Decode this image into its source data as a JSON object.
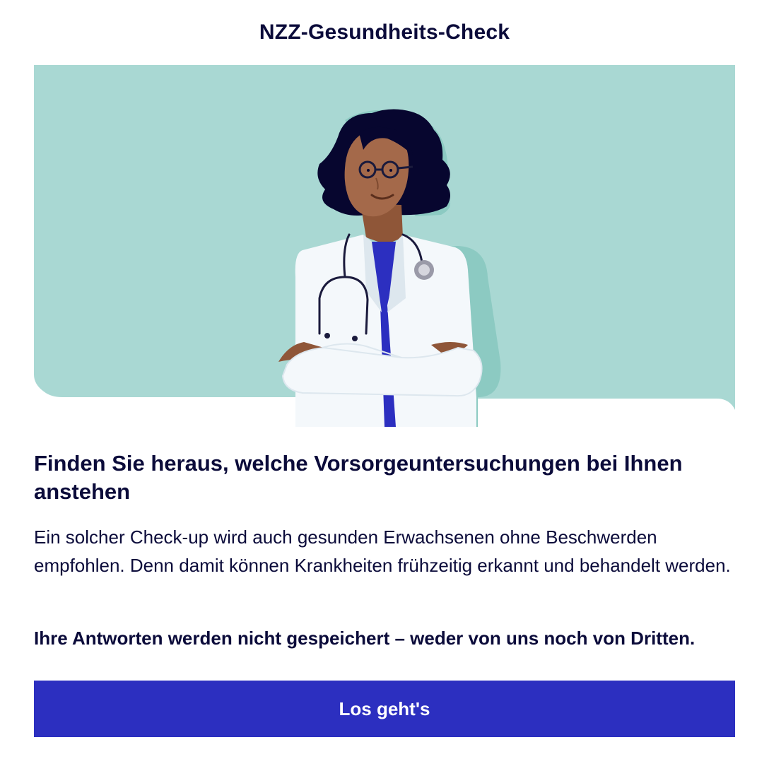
{
  "header": {
    "title": "NZZ-Gesundheits-Check"
  },
  "hero": {
    "illustration": "doctor-illustration",
    "colors": {
      "background": "#a9d8d3",
      "skin": "#a4694a",
      "hair": "#07062f",
      "coat": "#f4f8fb",
      "scrubs": "#2c2fc0",
      "stethoscope": "#1a1a3c",
      "chestpiece": "#9a9aa8"
    }
  },
  "content": {
    "headline": "Finden Sie heraus, welche Vorsorgeuntersuchungen bei Ihnen anstehen",
    "intro": "Ein solcher Check-up wird auch gesunden Erwachsenen ohne Beschwerden empfohlen. Denn damit können Krankheiten frühzeitig erkannt und behandelt werden.",
    "privacy_note": "Ihre Antworten werden nicht gespeichert – weder von uns noch von Dritten."
  },
  "cta": {
    "label": "Los geht's",
    "color": "#2c2fc0",
    "text_color": "#ffffff"
  }
}
